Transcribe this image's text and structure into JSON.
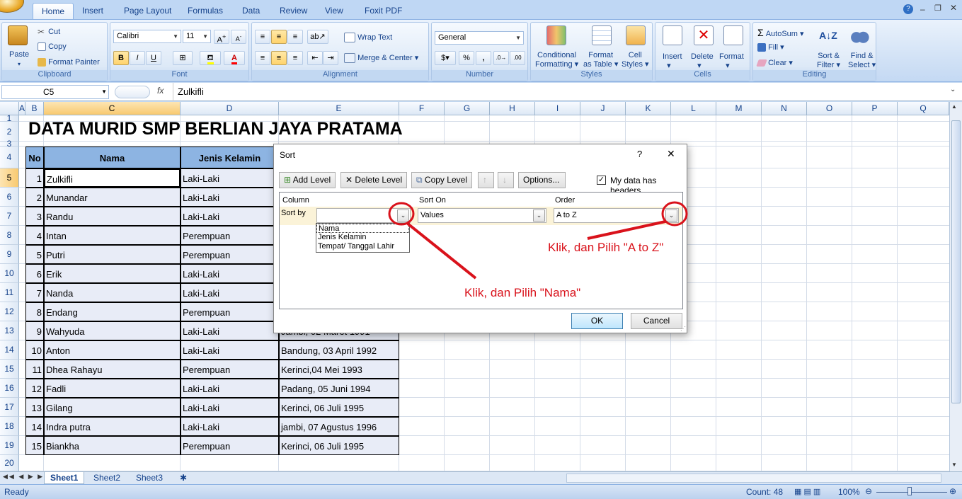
{
  "tabs": [
    "Home",
    "Insert",
    "Page Layout",
    "Formulas",
    "Data",
    "Review",
    "View",
    "Foxit PDF"
  ],
  "window_icons": [
    "help-icon",
    "minimize-icon",
    "restore-icon",
    "close-icon"
  ],
  "ribbon": {
    "clipboard": {
      "paste": "Paste",
      "cut": "Cut",
      "copy": "Copy",
      "format_painter": "Format Painter",
      "label": "Clipboard"
    },
    "font": {
      "name": "Calibri",
      "size": "11",
      "label": "Font",
      "bold": "B",
      "italic": "I",
      "underline": "U"
    },
    "alignment": {
      "wrap": "Wrap Text",
      "merge": "Merge & Center",
      "label": "Alignment"
    },
    "number": {
      "format": "General",
      "label": "Number",
      "percent": "%",
      "comma": ","
    },
    "styles": {
      "conditional": "Conditional",
      "formatting": "Formatting",
      "format_as": "Format",
      "as_table": "as Table",
      "cell": "Cell",
      "cell_styles": "Styles",
      "label": "Styles"
    },
    "cells": {
      "insert": "Insert",
      "delete": "Delete",
      "format": "Format",
      "label": "Cells"
    },
    "editing": {
      "autosum": "AutoSum",
      "fill": "Fill",
      "clear": "Clear",
      "sort1": "Sort &",
      "sort2": "Filter",
      "find1": "Find &",
      "find2": "Select",
      "label": "Editing"
    }
  },
  "formula_bar": {
    "name_box": "C5",
    "fx": "fx",
    "content": "Zulkifli"
  },
  "columns": [
    "A",
    "B",
    "C",
    "D",
    "E",
    "F",
    "G",
    "H",
    "I",
    "J",
    "K",
    "L",
    "M",
    "N",
    "O",
    "P",
    "Q"
  ],
  "rows": [
    "1",
    "2",
    "3",
    "4",
    "5",
    "6",
    "7",
    "8",
    "9",
    "10",
    "11",
    "12",
    "13",
    "14",
    "15",
    "16",
    "17",
    "18",
    "19",
    "20"
  ],
  "sheet_title": "DATA MURID SMP BERLIAN JAYA PRATAMA",
  "table": {
    "headers": [
      "No",
      "Nama",
      "Jenis Kelamin",
      "Tempat/ Tanggal Lahir"
    ],
    "rows": [
      [
        "1",
        "Zulkifli",
        "Laki-Laki",
        ""
      ],
      [
        "2",
        "Munandar",
        "Laki-Laki",
        ""
      ],
      [
        "3",
        "Randu",
        "Laki-Laki",
        ""
      ],
      [
        "4",
        "Intan",
        "Perempuan",
        ""
      ],
      [
        "5",
        "Putri",
        "Perempuan",
        ""
      ],
      [
        "6",
        "Erik",
        "Laki-Laki",
        ""
      ],
      [
        "7",
        "Nanda",
        "Laki-Laki",
        ""
      ],
      [
        "8",
        "Endang",
        "Perempuan",
        ""
      ],
      [
        "9",
        "Wahyuda",
        "Laki-Laki",
        "Jambi, 02 Maret 1991"
      ],
      [
        "10",
        "Anton",
        "Laki-Laki",
        "Bandung, 03 April 1992"
      ],
      [
        "11",
        "Dhea Rahayu",
        "Perempuan",
        "Kerinci,04 Mei 1993"
      ],
      [
        "12",
        "Fadli",
        "Laki-Laki",
        "Padang, 05 Juni 1994"
      ],
      [
        "13",
        "Gilang",
        "Laki-Laki",
        "Kerinci, 06 Juli 1995"
      ],
      [
        "14",
        "Indra putra",
        "Laki-Laki",
        "jambi, 07 Agustus 1996"
      ],
      [
        "15",
        "Biankha",
        "Perempuan",
        "Kerinci, 06 Juli 1995"
      ]
    ]
  },
  "sheets": [
    "Sheet1",
    "Sheet2",
    "Sheet3"
  ],
  "status": {
    "ready": "Ready",
    "count": "Count: 48",
    "zoom": "100%"
  },
  "dialog": {
    "title": "Sort",
    "help": "?",
    "close": "✕",
    "add_level": "Add Level",
    "delete_level": "Delete Level",
    "copy_level": "Copy Level",
    "options": "Options...",
    "my_data_headers": "My data has headers",
    "col_header_column": "Column",
    "col_header_sort_on": "Sort On",
    "col_header_order": "Order",
    "sort_by": "Sort by",
    "sort_on_value": "Values",
    "order_value": "A to Z",
    "column_options": [
      "Nama",
      "Jenis Kelamin",
      "Tempat/ Tanggal Lahir"
    ],
    "ok": "OK",
    "cancel": "Cancel"
  },
  "annotations": {
    "order_hint": "Klik, dan Pilih \"A to Z\"",
    "column_hint": "Klik, dan Pilih \"Nama\""
  },
  "colors": {
    "annotation": "#d9121b",
    "header_fill": "#8db4e2",
    "selected_column": "#f8c96f"
  }
}
